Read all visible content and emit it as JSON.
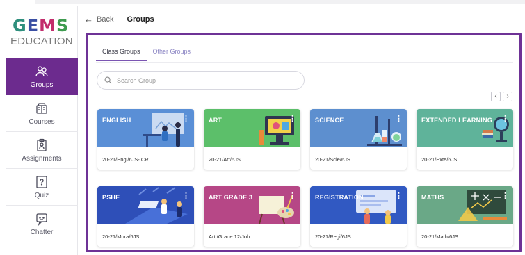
{
  "logo": {
    "letters": [
      "G",
      "E",
      "M",
      "S"
    ],
    "subtitle": "EDUCATION"
  },
  "sidebar": {
    "items": [
      {
        "label": "Groups",
        "icon": "users-icon",
        "active": true
      },
      {
        "label": "Courses",
        "icon": "courses-icon",
        "active": false
      },
      {
        "label": "Assignments",
        "icon": "assignment-icon",
        "active": false
      },
      {
        "label": "Quiz",
        "icon": "quiz-icon",
        "active": false
      },
      {
        "label": "Chatter",
        "icon": "chat-icon",
        "active": false
      }
    ]
  },
  "header": {
    "back_label": "Back",
    "breadcrumb": "Groups"
  },
  "tabs": [
    {
      "label": "Class Groups",
      "active": true
    },
    {
      "label": "Other Groups",
      "active": false
    }
  ],
  "search": {
    "placeholder": "Search Group"
  },
  "pager": {
    "prev": "‹",
    "next": "›"
  },
  "groups": [
    {
      "title": "ENGLISH",
      "code": "20-21/Engl/6JS- CR",
      "color": "#5a8fd6"
    },
    {
      "title": "ART",
      "code": "20-21/Art/6JS",
      "color": "#5cbf6a"
    },
    {
      "title": "SCIENCE",
      "code": "20-21/Scie/6JS",
      "color": "#5d8fcf"
    },
    {
      "title": "EXTENDED LEARNING",
      "code": "20-21/Exte/6JS",
      "color": "#5fb39a"
    },
    {
      "title": "PSHE",
      "code": "20-21/Mora/6JS",
      "color": "#2e4fb8"
    },
    {
      "title": "ART GRADE 3",
      "code": "Art /Grade 12/Joh",
      "color": "#b64786"
    },
    {
      "title": "REGISTRATION",
      "code": "20-21/Regi/6JS",
      "color": "#3159c2"
    },
    {
      "title": "MATHS",
      "code": "20-21/Math/6JS",
      "color": "#6aa887"
    }
  ]
}
